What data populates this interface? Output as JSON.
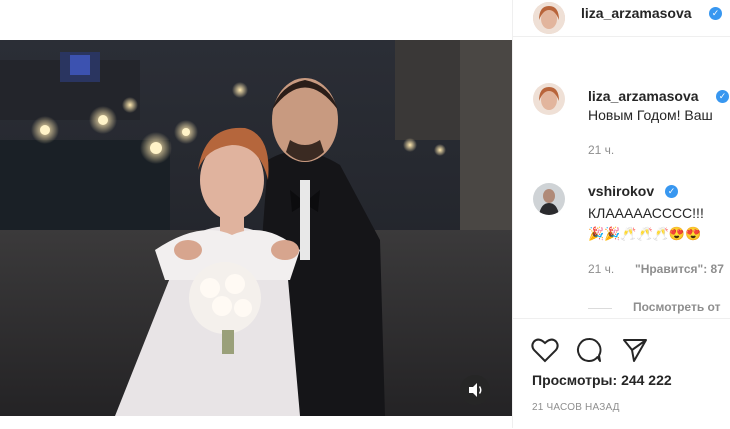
{
  "post": {
    "author": "liza_arzamasova",
    "caption_fragment": "Новым Годом! Ваш",
    "caption_time": "21 ч."
  },
  "comments": [
    {
      "author": "vshirokov",
      "text": "КЛАААААСССС!!!",
      "emoji": "🎉🎉🥂🥂🥂😍😍",
      "time": "21 ч.",
      "likes": "\"Нравится\": 87",
      "view_replies": "Посмотреть от"
    }
  ],
  "stats": {
    "views_label": "Просмотры:",
    "views_value": "244 222",
    "time_ago": "21 ЧАСОВ НАЗАД"
  },
  "icons": {
    "verified": "verified-badge-icon",
    "like": "heart-icon",
    "comment": "comment-bubble-icon",
    "share": "paper-plane-icon",
    "mute": "speaker-icon"
  },
  "colors": {
    "verified": "#3897f0",
    "text": "#262626",
    "muted": "#8e8e8e"
  }
}
